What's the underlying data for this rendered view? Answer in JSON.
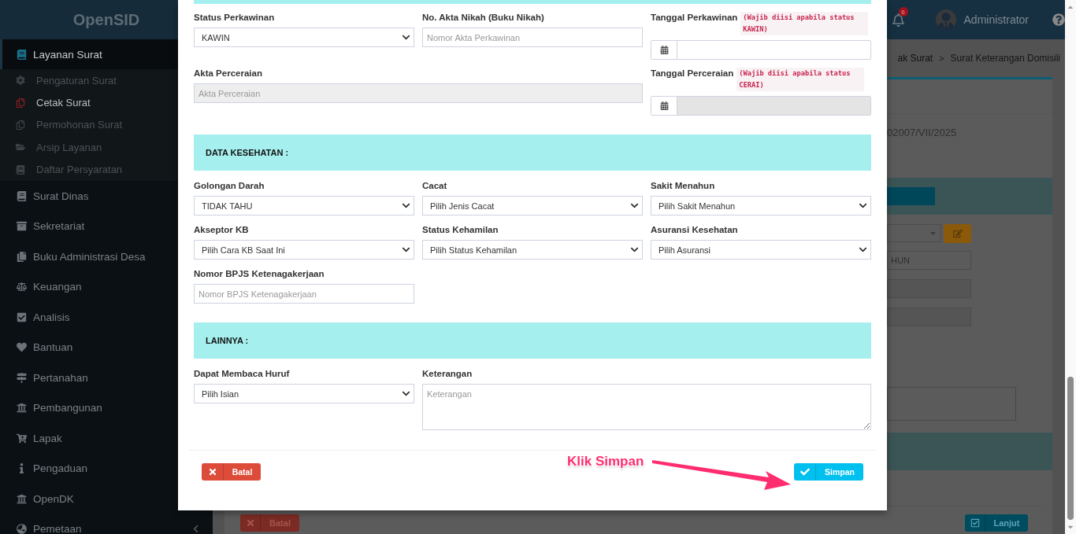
{
  "sidebar": {
    "brand": "OpenSID",
    "items": [
      {
        "label": "Layanan Surat",
        "selected": true,
        "expanded": true,
        "children": [
          {
            "label": "Pengaturan Surat",
            "selected": false
          },
          {
            "label": "Cetak Surat",
            "selected": true
          },
          {
            "label": "Permohonan Surat",
            "selected": false
          },
          {
            "label": "Arsip Layanan",
            "selected": false
          },
          {
            "label": "Daftar Persyaratan",
            "selected": false
          }
        ]
      },
      {
        "label": "Surat Dinas",
        "selected": false
      },
      {
        "label": "Sekretariat",
        "selected": false
      },
      {
        "label": "Buku Administrasi Desa",
        "selected": false
      },
      {
        "label": "Keuangan",
        "selected": false
      },
      {
        "label": "Analisis",
        "selected": false
      },
      {
        "label": "Bantuan",
        "selected": false
      },
      {
        "label": "Pertanahan",
        "selected": false
      },
      {
        "label": "Pembangunan",
        "selected": false
      },
      {
        "label": "Lapak",
        "selected": false
      },
      {
        "label": "Pengaduan",
        "selected": false
      },
      {
        "label": "OpenDK",
        "selected": false
      },
      {
        "label": "Pemetaan",
        "selected": false
      }
    ]
  },
  "header": {
    "notifications": "6",
    "user": "Administrator"
  },
  "breadcrumb": {
    "items": [
      "ak Surat",
      "Surat Keterangan Domisili"
    ],
    "separator": ">"
  },
  "background_form": {
    "number": "02007/VII/2025",
    "field_value": "HUN",
    "buttons": [
      {
        "kind": "cancel",
        "label": "Batal"
      },
      {
        "kind": "next",
        "label": "Lanjut"
      }
    ]
  },
  "modal": {
    "sections": [
      {
        "fields": [
          {
            "label": "Status Perkawinan",
            "kind": "select",
            "value": "KAWIN",
            "disabled": false
          },
          {
            "label": "No. Akta Nikah (Buku Nikah)",
            "kind": "text",
            "placeholder": "Nomor Akta Perkawinan",
            "disabled": false
          },
          {
            "label": "Tanggal Perkawinan",
            "hint": "(Wajib diisi apabila status KAWIN)",
            "kind": "date",
            "disabled": false
          },
          {
            "label": "Akta Perceraian",
            "kind": "wide-text",
            "placeholder": "Akta Perceraian",
            "disabled": true
          },
          {
            "label": "Tanggal Perceraian",
            "hint": "(Wajib diisi apabila status CERAI)",
            "kind": "date",
            "disabled": true
          }
        ]
      },
      {
        "title": "DATA KESEHATAN :",
        "fields": [
          {
            "label": "Golongan Darah",
            "kind": "select",
            "value": "TIDAK TAHU",
            "disabled": false
          },
          {
            "label": "Cacat",
            "kind": "select",
            "value": "Pilih Jenis Cacat",
            "disabled": false
          },
          {
            "label": "Sakit Menahun",
            "kind": "select",
            "value": "Pilih Sakit Menahun",
            "disabled": false
          },
          {
            "label": "Akseptor KB",
            "kind": "select",
            "value": "Pilih Cara KB Saat Ini",
            "disabled": false
          },
          {
            "label": "Status Kehamilan",
            "kind": "select",
            "value": "Pilih Status Kehamilan",
            "disabled": false
          },
          {
            "label": "Asuransi Kesehatan",
            "kind": "select",
            "value": "Pilih Asuransi",
            "disabled": false
          },
          {
            "label": "Nomor BPJS Ketenagakerjaan",
            "kind": "text",
            "placeholder": "Nomor BPJS Ketenagakerjaan",
            "disabled": false
          }
        ]
      },
      {
        "title": "LAINNYA :",
        "fields": [
          {
            "label": "Dapat Membaca Huruf",
            "kind": "select",
            "value": "Pilih Isian",
            "disabled": false
          },
          {
            "label": "Keterangan",
            "kind": "textarea",
            "placeholder": "Keterangan",
            "disabled": false
          }
        ]
      }
    ],
    "buttons": [
      {
        "kind": "cancel",
        "label": "Batal"
      },
      {
        "kind": "save",
        "label": "Simpan"
      }
    ]
  },
  "annotation": {
    "text": "Klik Simpan"
  }
}
